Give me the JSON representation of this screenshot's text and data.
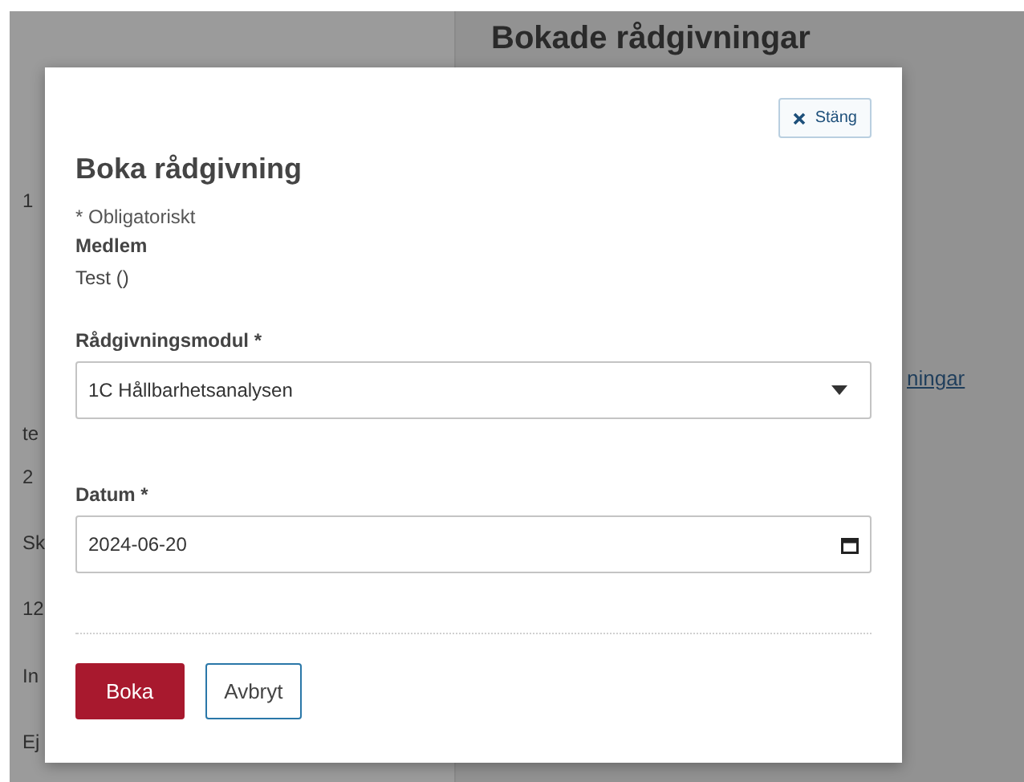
{
  "background": {
    "heading": "Bokade rådgivningar",
    "link": "ningar",
    "left_texts": [
      "1",
      "te",
      "2",
      "Sk",
      "12",
      "In",
      "Ej"
    ]
  },
  "dialog": {
    "close_button": "Stäng",
    "title": "Boka rådgivning",
    "required_note": "* Obligatoriskt",
    "member_label": "Medlem",
    "member_value": "Test ()",
    "fields": [
      {
        "kind": "select",
        "label": "Rådgivningsmodul *",
        "value": "1C Hållbarhetsanalysen"
      },
      {
        "kind": "date",
        "label": "Datum *",
        "value": "2024-06-20"
      }
    ],
    "buttons": [
      {
        "kind": "primary",
        "label": "Boka"
      },
      {
        "kind": "secondary",
        "label": "Avbryt"
      }
    ]
  }
}
